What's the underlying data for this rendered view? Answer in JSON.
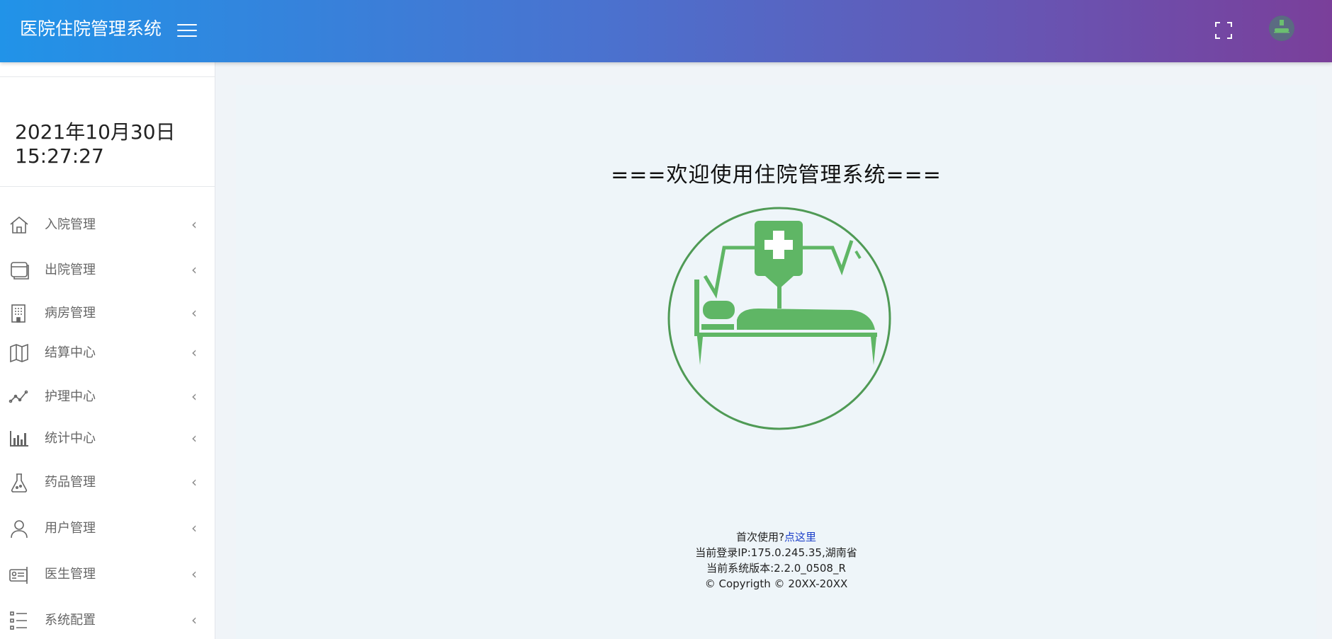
{
  "header": {
    "title": "医院住院管理系统",
    "menu_icon": "hamburger-icon",
    "fullscreen_icon": "fullscreen-icon",
    "avatar_icon": "user-avatar"
  },
  "sidebar": {
    "date": "2021年10月30日",
    "time": "15:27:27",
    "items": [
      {
        "label": "入院管理",
        "icon": "home-icon"
      },
      {
        "label": "出院管理",
        "icon": "window-icon"
      },
      {
        "label": "病房管理",
        "icon": "building-icon"
      },
      {
        "label": "结算中心",
        "icon": "map-icon"
      },
      {
        "label": "护理中心",
        "icon": "line-chart-icon"
      },
      {
        "label": "统计中心",
        "icon": "bar-chart-icon"
      },
      {
        "label": "药品管理",
        "icon": "flask-icon"
      },
      {
        "label": "用户管理",
        "icon": "user-icon"
      },
      {
        "label": "医生管理",
        "icon": "id-card-icon"
      },
      {
        "label": "系统配置",
        "icon": "list-icon"
      }
    ]
  },
  "main": {
    "welcome": "===欢迎使用住院管理系统===",
    "first_use_prefix": "首次使用?",
    "first_use_link": "点这里",
    "login_ip": "当前登录IP:175.0.245.35,湖南省",
    "version": "当前系统版本:2.2.0_0508_R",
    "copyright": "© Copyrigth © 20XX-20XX"
  },
  "colors": {
    "header_gradient_start": "#2193e8",
    "header_gradient_end": "#7a3f9a",
    "logo_green": "#5fb665",
    "link": "#1a3ec9"
  }
}
